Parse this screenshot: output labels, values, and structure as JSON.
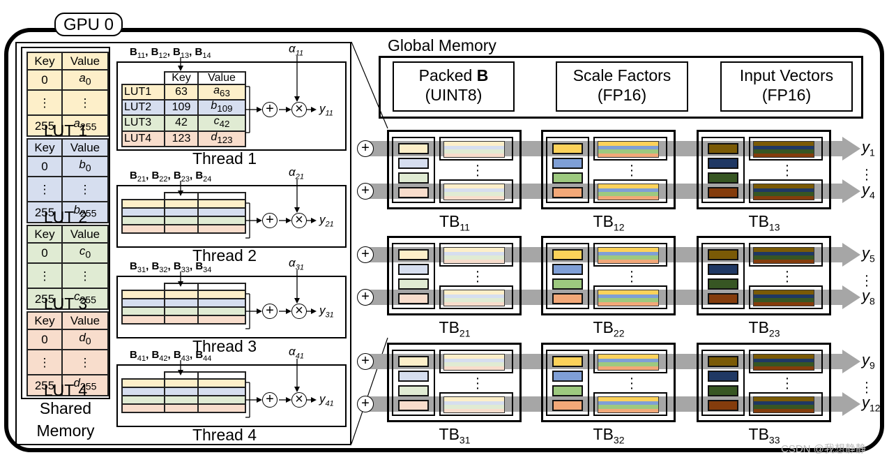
{
  "gpu_label": "GPU 0",
  "shared_memory": {
    "label_line1": "Shared",
    "label_line2": "Memory",
    "luts": [
      {
        "name": "LUT 1",
        "color": "#fdefc9",
        "header_key": "Key",
        "header_value": "Value",
        "rows": [
          {
            "key": "0",
            "value": "a",
            "sub": "0"
          },
          {
            "key": "⋮",
            "value": "⋮",
            "sub": ""
          },
          {
            "key": "255",
            "value": "a",
            "sub": "255"
          }
        ]
      },
      {
        "name": "LUT 2",
        "color": "#d6deef",
        "header_key": "Key",
        "header_value": "Value",
        "rows": [
          {
            "key": "0",
            "value": "b",
            "sub": "0"
          },
          {
            "key": "⋮",
            "value": "⋮",
            "sub": ""
          },
          {
            "key": "255",
            "value": "b",
            "sub": "255"
          }
        ]
      },
      {
        "name": "LUT 3",
        "color": "#e0ebd3",
        "header_key": "Key",
        "header_value": "Value",
        "rows": [
          {
            "key": "0",
            "value": "c",
            "sub": "0"
          },
          {
            "key": "⋮",
            "value": "⋮",
            "sub": ""
          },
          {
            "key": "255",
            "value": "c",
            "sub": "255"
          }
        ]
      },
      {
        "name": "LUT 4",
        "color": "#f8ddcc",
        "header_key": "Key",
        "header_value": "Value",
        "rows": [
          {
            "key": "0",
            "value": "d",
            "sub": "0"
          },
          {
            "key": "⋮",
            "value": "⋮",
            "sub": ""
          },
          {
            "key": "255",
            "value": "d",
            "sub": "255"
          }
        ]
      }
    ]
  },
  "threads": [
    {
      "label": "Thread 1",
      "b_inputs": [
        "11",
        "12",
        "13",
        "14"
      ],
      "alpha_sub": "11",
      "y_sub": "11",
      "table": {
        "header_key": "Key",
        "header_value": "Value",
        "rows": [
          {
            "lut": "LUT1",
            "key": "63",
            "value": "a",
            "sub": "63"
          },
          {
            "lut": "LUT2",
            "key": "109",
            "value": "b",
            "sub": "109"
          },
          {
            "lut": "LUT3",
            "key": "42",
            "value": "c",
            "sub": "42"
          },
          {
            "lut": "LUT4",
            "key": "123",
            "value": "d",
            "sub": "123"
          }
        ]
      }
    },
    {
      "label": "Thread 2",
      "b_inputs": [
        "21",
        "22",
        "23",
        "24"
      ],
      "alpha_sub": "21",
      "y_sub": "21"
    },
    {
      "label": "Thread 3",
      "b_inputs": [
        "31",
        "32",
        "33",
        "34"
      ],
      "alpha_sub": "31",
      "y_sub": "31"
    },
    {
      "label": "Thread 4",
      "b_inputs": [
        "41",
        "42",
        "43",
        "44"
      ],
      "alpha_sub": "41",
      "y_sub": "41"
    }
  ],
  "symbols": {
    "b_letter": "B",
    "alpha_letter": "α",
    "y_letter": "y",
    "plus": "+",
    "times": "×"
  },
  "global_memory": {
    "title": "Global Memory",
    "items": [
      {
        "line1": "Packed ",
        "line1_bold": "B",
        "line2": "(UINT8)"
      },
      {
        "line1": "Scale Factors",
        "line1_bold": "",
        "line2": "(FP16)"
      },
      {
        "line1": "Input Vectors",
        "line1_bold": "",
        "line2": "(FP16)"
      }
    ]
  },
  "thread_blocks": {
    "rows": [
      {
        "outputs": [
          {
            "letter": "y",
            "sub": "1"
          },
          {
            "letter": "y",
            "sub": "4"
          }
        ],
        "blocks": [
          "11",
          "12",
          "13"
        ]
      },
      {
        "outputs": [
          {
            "letter": "y",
            "sub": "5"
          },
          {
            "letter": "y",
            "sub": "8"
          }
        ],
        "blocks": [
          "21",
          "22",
          "23"
        ]
      },
      {
        "outputs": [
          {
            "letter": "y",
            "sub": "9"
          },
          {
            "letter": "y",
            "sub": "12"
          }
        ],
        "blocks": [
          "31",
          "32",
          "33"
        ]
      }
    ],
    "block_prefix": "TB",
    "palettes": [
      [
        "#fdefc9",
        "#d6deef",
        "#e0ebd3",
        "#f8ddcc"
      ],
      [
        "#fcd25a",
        "#7f9fd6",
        "#9dc97f",
        "#f2a878"
      ],
      [
        "#7a5a06",
        "#1f3864",
        "#375623",
        "#843c0c"
      ]
    ],
    "band_color": "#a6a6a6"
  },
  "watermark": "CSDN @我想静静"
}
